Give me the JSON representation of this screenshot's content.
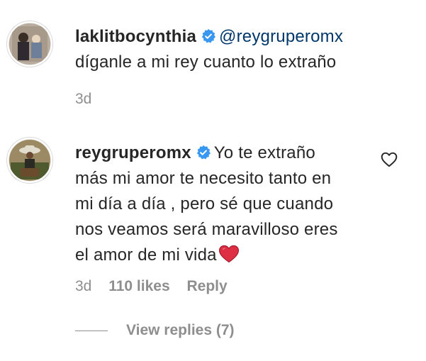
{
  "comments": [
    {
      "username": "laklitbocynthia",
      "mention": "@reygruperomx",
      "text_lines": [
        "díganle a mi rey cuanto lo extraño"
      ],
      "time": "3d"
    },
    {
      "username": "reygruperomx",
      "text_lines": [
        "Yo te extraño",
        "más mi amor te necesito tanto en",
        "mi día a día , pero sé que cuando",
        "nos veamos será maravilloso eres",
        "el amor de mi vida"
      ],
      "time": "3d",
      "likes": "110 likes",
      "reply_label": "Reply",
      "view_replies": "View replies (7)"
    }
  ],
  "icons": {
    "verified": "verified-badge-icon",
    "like": "heart-outline-icon",
    "emoji": "red-heart-emoji"
  },
  "colors": {
    "text": "#262626",
    "secondary": "#8e8e8e",
    "verified": "#3897f0",
    "mention": "#00376b",
    "heart": "#ed4956"
  }
}
